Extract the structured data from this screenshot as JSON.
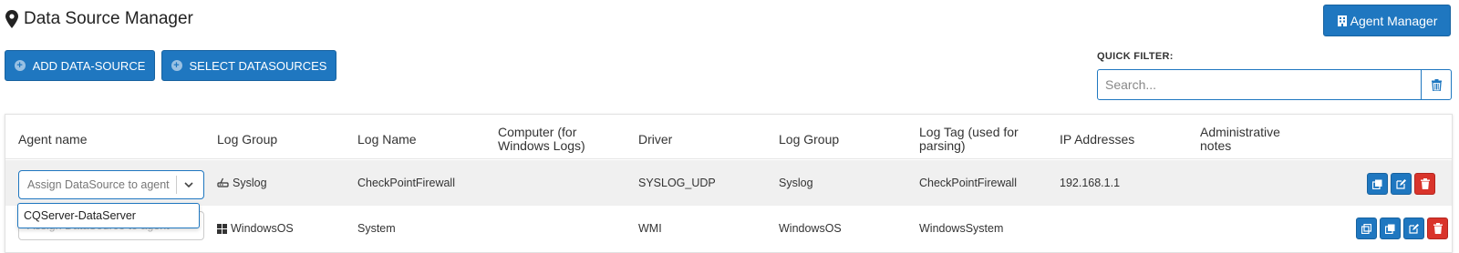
{
  "header": {
    "title": "Data Source Manager",
    "agent_manager_label": "Agent Manager"
  },
  "toolbar": {
    "add_label": "ADD DATA-SOURCE",
    "select_label": "SELECT DATASOURCES"
  },
  "quick_filter": {
    "label": "QUICK FILTER:",
    "placeholder": "Search..."
  },
  "table": {
    "columns": [
      "Agent name",
      "Log Group",
      "Log Name",
      "Computer (for Windows Logs)",
      "Driver",
      "Log Group",
      "Log Tag (used for parsing)",
      "IP Addresses",
      "Administrative notes"
    ],
    "rows": [
      {
        "agent_placeholder": "Assign DataSource to agent",
        "log_group": "Syslog",
        "log_group_icon": "network-icon",
        "log_name": "CheckPointFirewall",
        "computer": "",
        "driver": "SYSLOG_UDP",
        "log_group2": "Syslog",
        "log_tag": "CheckPointFirewall",
        "ip": "192.168.1.1",
        "notes": ""
      },
      {
        "agent_placeholder": "Assign DataSource to agent",
        "log_group": "WindowsOS",
        "log_group_icon": "windows-icon",
        "log_name": "System",
        "computer": "",
        "driver": "WMI",
        "log_group2": "WindowsOS",
        "log_tag": "WindowsSystem",
        "ip": "",
        "notes": ""
      }
    ]
  },
  "dropdown": {
    "option": "CQServer-DataServer"
  },
  "colors": {
    "primary": "#1f77c0",
    "danger": "#d9342b",
    "row_highlight": "#f0f0f0"
  }
}
